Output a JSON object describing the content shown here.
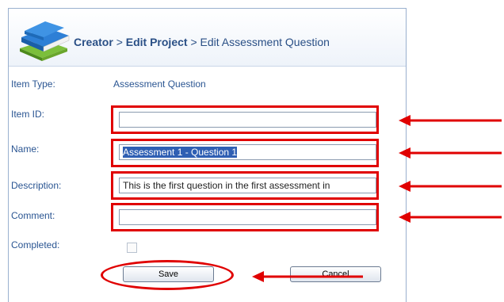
{
  "header": {
    "crumb_root": "Creator",
    "crumb_sep1": ">",
    "crumb_edit_project": "Edit Project",
    "crumb_sep2": ">",
    "crumb_current": "Edit Assessment Question"
  },
  "form": {
    "item_type_label": "Item Type:",
    "item_type_value": "Assessment Question",
    "item_id_label": "Item ID:",
    "item_id_value": "",
    "name_label": "Name:",
    "name_value": "Assessment 1 - Question 1",
    "description_label": "Description:",
    "description_value": "This is the first question in the first assessment in",
    "comment_label": "Comment:",
    "comment_value": "",
    "completed_label": "Completed:",
    "completed_checked": false
  },
  "buttons": {
    "save_label": "Save",
    "cancel_label": "Cancel"
  },
  "annotation": {
    "highlight_color": "#e00000"
  },
  "icons": {
    "logo": "stacked-books-icon",
    "arrow": "red-arrow-left-icon"
  }
}
